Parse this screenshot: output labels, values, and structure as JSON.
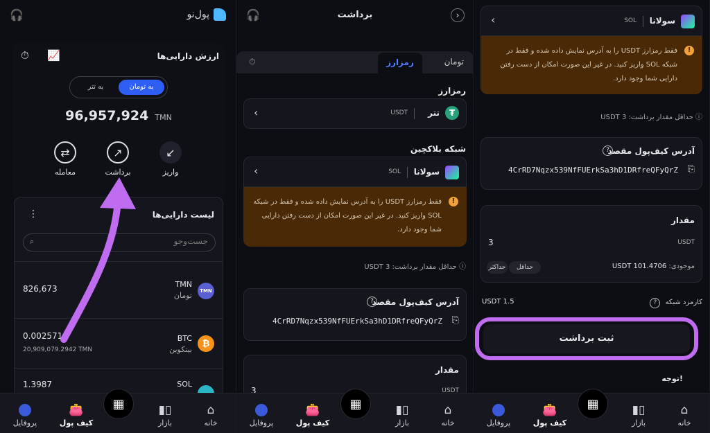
{
  "panel1": {
    "logo_text": "پول‌نو",
    "assets_value_title": "ارزش دارایی‌ها",
    "toggle_toman": "به تومان",
    "toggle_tether": "به تتر",
    "balance": "96,957,924",
    "balance_unit": "TMN",
    "actions": [
      {
        "label": "معامله",
        "icon": "exchange-icon"
      },
      {
        "label": "برداشت",
        "icon": "arrow-up-right-icon"
      },
      {
        "label": "واریز",
        "icon": "arrow-down-left-icon"
      }
    ],
    "asset_list_title": "لیست دارایی‌ها",
    "search_placeholder": "جست‌وجو",
    "assets": [
      {
        "symbol": "TMN",
        "name": "تومان",
        "amount": "826,673",
        "sub": "",
        "color": "#5b5fd6"
      },
      {
        "symbol": "BTC",
        "name": "بیتکوین",
        "amount": "0.0025716",
        "sub": "20,909,079.2942 TMN",
        "color": "#f7931a"
      },
      {
        "symbol": "SOL",
        "name": "",
        "amount": "1.3987",
        "sub": "",
        "color": "#2bb6c8"
      }
    ]
  },
  "panel2": {
    "title": "برداشت",
    "tab_toman": "تومان",
    "tab_crypto": "رمزارز",
    "crypto_label": "رمزارز",
    "crypto_name": "تتر",
    "crypto_code": "USDT",
    "network_label": "شبکه بلاکچین",
    "network_name": "سولانا",
    "network_code": "SOL",
    "warning": "فقط رمزارز USDT را به آدرس نمایش داده شده و فقط در شبکه SOL واریز کنید. در غیر این صورت امکان از دست رفتن دارایی شما وجود دارد.",
    "min_withdraw": "حداقل مقدار برداشت: USDT 3",
    "wallet_label": "آدرس کیف‌پول مقصد",
    "wallet_address": "4CrRD7Nqzx539NfFUErkSa3hD1DRfreQFyQrZ",
    "amount_label": "مقدار",
    "amount_value": "3",
    "amount_unit": "USDT"
  },
  "panel3": {
    "network_name": "سولانا",
    "network_code": "SOL",
    "warning": "فقط رمزارز USDT را به آدرس نمایش داده شده و فقط در شبکه SOL واریز کنید. در غیر این صورت امکان از دست رفتن دارایی شما وجود دارد.",
    "min_withdraw": "حداقل مقدار برداشت: USDT 3",
    "wallet_label": "آدرس کیف‌پول مقصد",
    "wallet_address": "4CrRD7Nqzx539NfFUErkSa3hD1DRfreQFyQrZ",
    "amount_label": "مقدار",
    "amount_value": "3",
    "amount_unit": "USDT",
    "balance_label": "موجودی:",
    "balance_value": "USDT 101.4706",
    "min_pill": "حداقل",
    "max_pill": "حداکثر",
    "fee_label": "کارمزد شبکه",
    "fee_value": "USDT 1.5",
    "submit": "ثبت برداشت",
    "attention": "توجه!"
  },
  "nav": {
    "home": "خانه",
    "market": "بازار",
    "wallet": "کیف پول",
    "profile": "پروفایل"
  },
  "colors": {
    "accent": "#2f5ef5",
    "highlight": "#c06cf0",
    "warning_bg": "#4a2a06",
    "tether": "#26a17b"
  }
}
